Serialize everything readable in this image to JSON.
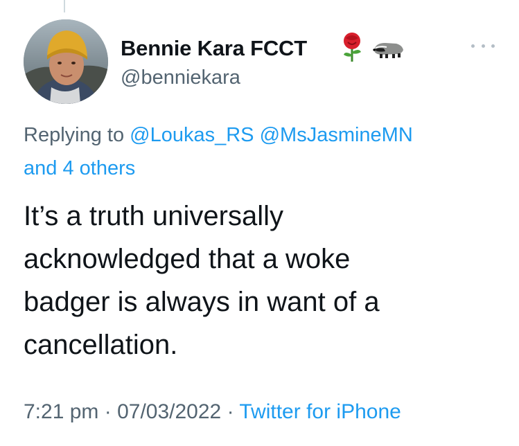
{
  "author": {
    "display_name": "Bennie Kara FCCT",
    "handle": "@benniekara",
    "name_emojis": [
      "rose-icon",
      "badger-icon"
    ]
  },
  "reply": {
    "prefix": "Replying to",
    "mentions": [
      "@Loukas_RS",
      "@MsJasmineMN"
    ],
    "others": "and 4 others"
  },
  "tweet": {
    "lines": [
      "It’s a truth universally",
      "acknowledged that a woke",
      "badger is always in want of a",
      "cancellation."
    ]
  },
  "meta": {
    "time": "7:21 pm",
    "separator": "·",
    "date": "07/03/2022",
    "source": "Twitter for iPhone"
  },
  "colors": {
    "link": "#1d9bf0",
    "secondary": "#536471",
    "text": "#0f1419"
  }
}
